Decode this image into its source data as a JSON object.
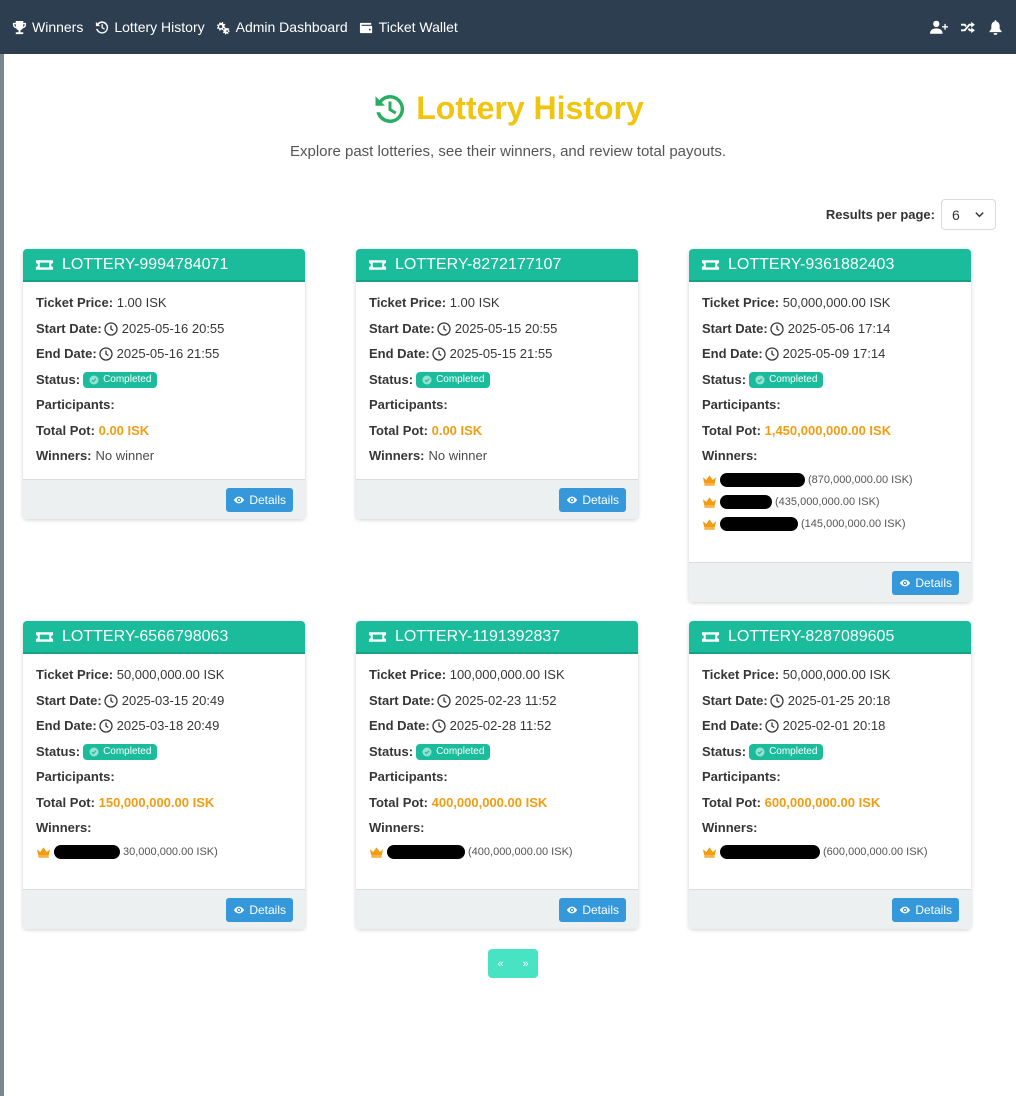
{
  "nav": {
    "items": [
      {
        "label": "Winners",
        "icon": "trophy-icon"
      },
      {
        "label": "Lottery History",
        "icon": "history-icon"
      },
      {
        "label": "Admin Dashboard",
        "icon": "cogs-icon"
      },
      {
        "label": "Ticket Wallet",
        "icon": "wallet-icon"
      }
    ],
    "right_icons": [
      "user-plus-icon",
      "random-icon",
      "bell-icon"
    ]
  },
  "header": {
    "title": "Lottery History",
    "subtitle": "Explore past lotteries, see their winners, and review total payouts."
  },
  "results_per_page": {
    "label": "Results per page:",
    "value": "6"
  },
  "labels": {
    "ticket_price": "Ticket Price:",
    "start_date": "Start Date:",
    "end_date": "End Date:",
    "status": "Status:",
    "participants": "Participants:",
    "total_pot": "Total Pot:",
    "winners": "Winners:",
    "details": "Details"
  },
  "lotteries": [
    {
      "id": "LOTTERY-9994784071",
      "ticket_price": "1.00 ISK",
      "start": "2025-05-16 20:55",
      "end": "2025-05-16 21:55",
      "status": "Completed",
      "pot": "0.00 ISK",
      "no_winner": "No winner",
      "winners": []
    },
    {
      "id": "LOTTERY-8272177107",
      "ticket_price": "1.00 ISK",
      "start": "2025-05-15 20:55",
      "end": "2025-05-15 21:55",
      "status": "Completed",
      "pot": "0.00 ISK",
      "no_winner": "No winner",
      "winners": []
    },
    {
      "id": "LOTTERY-9361882403",
      "ticket_price": "50,000,000.00 ISK",
      "start": "2025-05-06 17:14",
      "end": "2025-05-09 17:14",
      "status": "Completed",
      "pot": "1,450,000,000.00 ISK",
      "no_winner": "",
      "winners": [
        {
          "amount": "(870,000,000.00 ISK)"
        },
        {
          "amount": "(435,000,000.00 ISK)"
        },
        {
          "amount": "(145,000,000.00 ISK)"
        }
      ]
    },
    {
      "id": "LOTTERY-6566798063",
      "ticket_price": "50,000,000.00 ISK",
      "start": "2025-03-15 20:49",
      "end": "2025-03-18 20:49",
      "status": "Completed",
      "pot": "150,000,000.00 ISK",
      "no_winner": "",
      "winners": [
        {
          "amount": "30,000,000.00 ISK)"
        }
      ]
    },
    {
      "id": "LOTTERY-1191392837",
      "ticket_price": "100,000,000.00 ISK",
      "start": "2025-02-23 11:52",
      "end": "2025-02-28 11:52",
      "status": "Completed",
      "pot": "400,000,000.00 ISK",
      "no_winner": "",
      "winners": [
        {
          "amount": "(400,000,000.00 ISK)"
        }
      ]
    },
    {
      "id": "LOTTERY-8287089605",
      "ticket_price": "50,000,000.00 ISK",
      "start": "2025-01-25 20:18",
      "end": "2025-02-01 20:18",
      "status": "Completed",
      "pot": "600,000,000.00 ISK",
      "no_winner": "",
      "winners": [
        {
          "amount": "(600,000,000.00 ISK)"
        }
      ]
    }
  ],
  "pagination": {
    "prev": "«",
    "next": "»"
  },
  "colors": {
    "navbar": "#2c3e50",
    "accent": "#1abc9c",
    "title": "#f1c40f",
    "pot": "#f39c12",
    "button": "#3498db"
  }
}
